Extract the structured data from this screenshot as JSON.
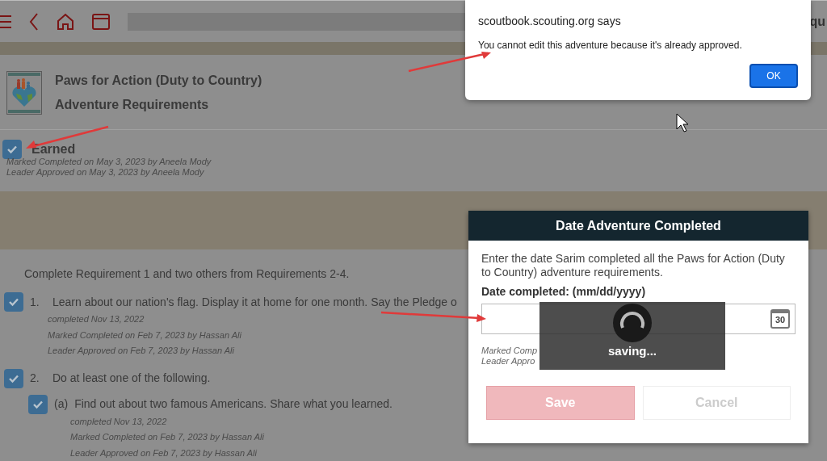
{
  "header": {
    "fragment": "qu"
  },
  "adventure": {
    "title": "Paws for Action (Duty to Country)",
    "subtitle": "Adventure Requirements",
    "earned": {
      "label": "Earned",
      "checked": true,
      "notes": [
        "Marked Completed on May 3, 2023 by Aneela Mody",
        "Leader Approved on May 3, 2023 by Aneela Mody"
      ]
    }
  },
  "requirements": {
    "intro": "Complete Requirement 1 and two others from Requirements 2-4.",
    "items": [
      {
        "number": "1.",
        "text": "Learn about our nation's flag. Display it at home for one month. Say the Pledge o",
        "checked": true,
        "notes": [
          "completed Nov 13, 2022",
          "Marked Completed on Feb 7, 2023 by Hassan Ali",
          "Leader Approved on Feb 7, 2023 by Hassan Ali"
        ]
      },
      {
        "number": "2.",
        "text": "Do at least one of the following.",
        "checked": true,
        "children": [
          {
            "number": "(a)",
            "text": "Find out about two famous Americans. Share what you learned.",
            "checked": true,
            "notes": [
              "completed Nov 13, 2022",
              "Marked Completed on Feb 7, 2023 by Hassan Ali",
              "Leader Approved on Feb 7, 2023 by Hassan Ali"
            ]
          }
        ]
      }
    ]
  },
  "alert": {
    "origin": "scoutbook.scouting.org says",
    "message": "You cannot edit this adventure because it's already approved.",
    "button": "OK"
  },
  "dialog": {
    "title": "Date Adventure Completed",
    "message": "Enter the date Sarim completed all the Paws for Action (Duty to Country) adventure requirements.",
    "field_label": "Date completed: (mm/dd/yyyy)",
    "calendar_day": "30",
    "notes": [
      "Marked Comp",
      "Leader Appro"
    ],
    "buttons": [
      {
        "label": "Save",
        "kind": "primary",
        "disabled": true
      },
      {
        "label": "Cancel",
        "kind": "secondary",
        "disabled": true
      }
    ]
  },
  "loading": {
    "text": "saving..."
  }
}
